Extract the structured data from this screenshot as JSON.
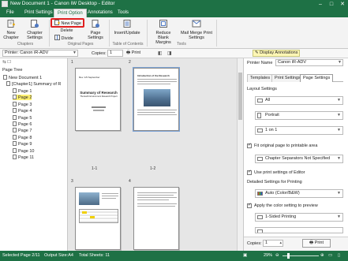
{
  "window": {
    "title": "New Document 1 - Canon iW Desktop - Editor"
  },
  "ribbon_tabs": [
    {
      "label": "File"
    },
    {
      "label": "Print Settings"
    },
    {
      "label": "Print Option"
    },
    {
      "label": "Annotations"
    },
    {
      "label": "Tools"
    }
  ],
  "ribbon": {
    "new_chapter": "New Chapter",
    "chapter_settings": "Chapter Settings",
    "group_chapters": "Chapters",
    "new_page": "New Page",
    "delete": "Delete",
    "divide": "Divide",
    "page_settings": "Page Settings",
    "group_original_pages": "Original Pages",
    "insert_update": "Insert/Update",
    "group_toc": "Table of Contents",
    "reduce_blank_margins": "Reduce Blank Margins",
    "mail_merge": "Mail Merge Print Settings",
    "group_tools": "Tools"
  },
  "printer_toolbar": {
    "printer_label": "Printer: Canon iR-ADV",
    "copies_label": "Copies:",
    "copies_value": "1",
    "print_label": "Print"
  },
  "display_annotations": "Display Annotations",
  "page_tree": {
    "title": "Page Tree",
    "document": "New Document 1",
    "chapter": "[Chapter1] Summary of R",
    "pages": [
      "Page 1",
      "Page 2",
      "Page 3",
      "Page 4",
      "Page 5",
      "Page 6",
      "Page 7",
      "Page 8",
      "Page 9",
      "Page 10",
      "Page 11"
    ],
    "selected_index": 1
  },
  "center": {
    "col_numbers": [
      "1",
      "2",
      "3",
      "4"
    ],
    "page_labels": [
      "1-1",
      "1-2"
    ],
    "doc1": {
      "small_header": "Rev. 1/9 September",
      "title": "Summary of Research",
      "subtitle": "The Earth Environment Research Project"
    },
    "doc2": {
      "header": "Introduction of the Research"
    }
  },
  "print_panel": {
    "printer_name_label": "Printer Name",
    "printer_name_value": "Canon iR-ADV",
    "tabs": [
      "Templates",
      "Print Settings",
      "Page Settings"
    ],
    "active_tab": 2,
    "layout_settings_label": "Layout Settings",
    "layout_all": "All",
    "orientation": "Portrait",
    "pages_per_sheet": "1 on 1",
    "fit_original": "Fit original page to printable area",
    "chapter_separators": "Chapter Separators Not Specified",
    "use_print_settings": "Use print settings of Editor",
    "detailed_settings_label": "Detailed Settings for Printing",
    "color_mode": "Auto (Color/B&W)",
    "apply_color": "Apply the color setting to preview",
    "sided": "1-Sided Printing",
    "copies_label": "Copies:",
    "copies_value": "1",
    "print_button": "Print"
  },
  "statusbar": {
    "selected_page": "Selected Page 2/11",
    "output_size": "Output Size:A4",
    "total_sheets": "Total Sheets: 11",
    "zoom": "29%"
  }
}
